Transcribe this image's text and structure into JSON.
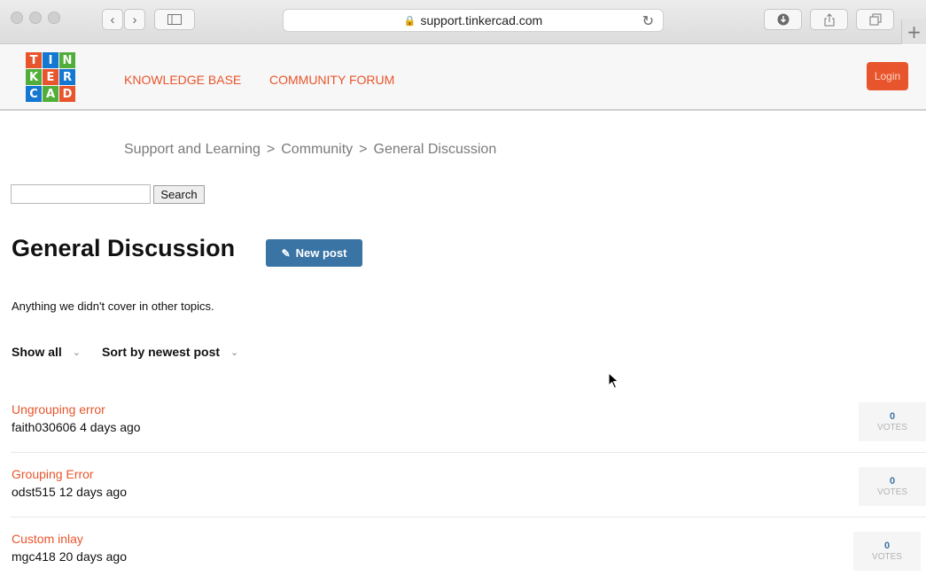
{
  "browser": {
    "url": "support.tinkercad.com",
    "icons": {
      "back": "chevron-left-icon",
      "forward": "chevron-right-icon",
      "sidebar": "sidebar-icon",
      "lock": "lock-icon",
      "reload": "reload-icon",
      "downloads": "download-icon",
      "share": "share-icon",
      "tabs": "tabs-icon",
      "new_tab": "plus-icon"
    }
  },
  "header": {
    "logo_letters": [
      "T",
      "I",
      "N",
      "K",
      "E",
      "R",
      "C",
      "A",
      "D"
    ],
    "logo_colors": [
      "#e8552c",
      "#1477d1",
      "#52ae3a",
      "#52ae3a",
      "#e8552c",
      "#1477d1",
      "#1477d1",
      "#52ae3a",
      "#e8552c"
    ],
    "nav": [
      "KNOWLEDGE BASE",
      "COMMUNITY FORUM"
    ],
    "login_label": "Login"
  },
  "breadcrumb": [
    "Support and Learning",
    "Community",
    "General Discussion"
  ],
  "breadcrumb_separator": ">",
  "search": {
    "value": "",
    "button_label": "Search"
  },
  "topic": {
    "title": "General Discussion",
    "new_post_label": "New post",
    "description": "Anything we didn't cover in other topics."
  },
  "filters": {
    "show": "Show all",
    "sort": "Sort by newest post"
  },
  "posts": [
    {
      "title": "Ungrouping error",
      "meta": "faith030606 4 days ago",
      "votes": "0",
      "votes_label": "VOTES"
    },
    {
      "title": "Grouping Error",
      "meta": "odst515 12 days ago",
      "votes": "0",
      "votes_label": "VOTES"
    },
    {
      "title": "Custom inlay",
      "meta": "mgc418 20 days ago",
      "votes": "0",
      "votes_label": "VOTES"
    }
  ],
  "colors": {
    "accent": "#e8552c",
    "primary_button": "#3a74a5",
    "vote_count": "#3a74a5"
  }
}
